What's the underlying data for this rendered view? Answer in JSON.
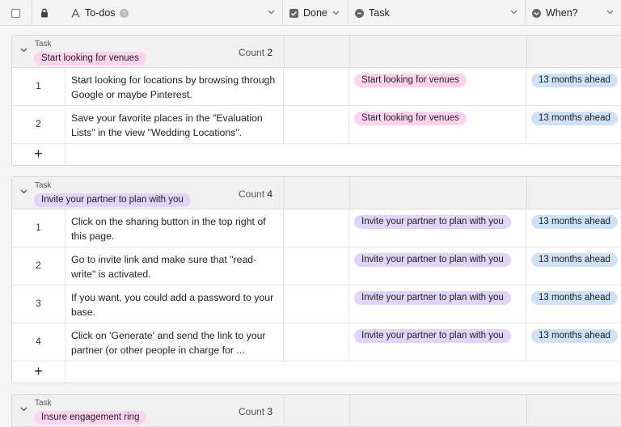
{
  "header": {
    "columns": [
      {
        "label": "To-dos",
        "icon": "text-icon"
      },
      {
        "label": "Done",
        "icon": "checkbox-icon"
      },
      {
        "label": "Task",
        "icon": "link-icon"
      },
      {
        "label": "When?",
        "icon": "lookup-icon"
      }
    ]
  },
  "colors": {
    "venues_chip": "#fdd3f0",
    "partner_chip": "#e0d4f8",
    "ring_chip": "#fdd3f0",
    "when_chip": "#cfe2f5"
  },
  "groups": [
    {
      "field": "Task",
      "name": "Start looking for venues",
      "count_label": "Count",
      "count": "2",
      "rows": [
        {
          "num": "1",
          "todo": "Start looking for locations by browsing through Google or maybe Pinterest.",
          "task": "Start looking for venues",
          "when": "13 months ahead"
        },
        {
          "num": "2",
          "todo": "Save your favorite places in the \"Evaluation Lists\" in the view \"Wedding Locations\".",
          "task": "Start looking for venues",
          "when": "13 months ahead"
        }
      ],
      "add": "+"
    },
    {
      "field": "Task",
      "name": "Invite your partner to plan with you",
      "count_label": "Count",
      "count": "4",
      "rows": [
        {
          "num": "1",
          "todo": "Click on the sharing button in the top right of this page.",
          "task": "Invite your partner to plan with you",
          "when": "13 months ahead"
        },
        {
          "num": "2",
          "todo": "Go to invite link and make sure that \"read-write\" is activated.",
          "task": "Invite your partner to plan with you",
          "when": "13 months ahead"
        },
        {
          "num": "3",
          "todo": "If you want, you could add a password to your base.",
          "task": "Invite your partner to plan with you",
          "when": "13 months ahead"
        },
        {
          "num": "4",
          "todo": "Click on 'Generate' and send the link to your partner (or other people in charge for ...",
          "task": "Invite your partner to plan with you",
          "when": "13 months ahead"
        }
      ],
      "add": "+"
    },
    {
      "field": "Task",
      "name": "Insure engagement ring",
      "count_label": "Count",
      "count": "3",
      "rows": [],
      "add": ""
    }
  ]
}
